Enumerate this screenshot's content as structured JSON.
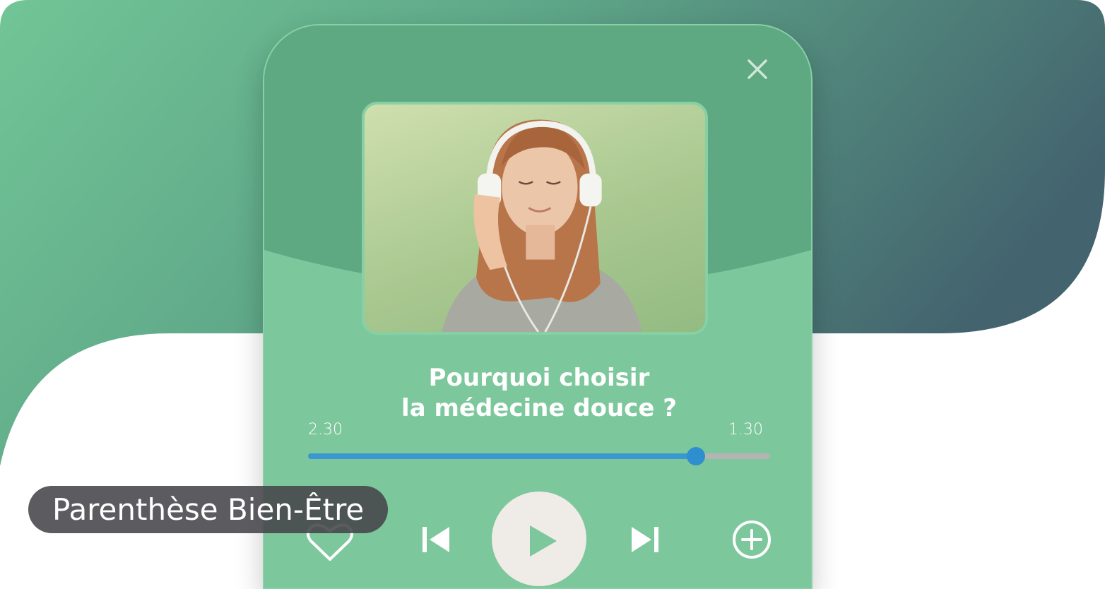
{
  "player": {
    "title_line1": "Pourquoi choisir",
    "title_line2": "la médecine douce ?",
    "elapsed": "2.30",
    "remaining": "1.30",
    "progress": 0.84,
    "cover_image": "woman-with-headphones-photo",
    "controls": {
      "like": "heart-icon",
      "previous": "skip-previous-icon",
      "play": "play-icon",
      "next": "skip-next-icon",
      "add": "plus-circle-icon",
      "close": "close-icon"
    }
  },
  "badge": {
    "label": "Parenthèse Bien-Être"
  },
  "colors": {
    "card_green": "#7cc79c",
    "card_top_green": "#5ea882",
    "progress_blue": "#3a97cf",
    "play_button": "#efebe6",
    "badge_bg": "#46464a"
  }
}
